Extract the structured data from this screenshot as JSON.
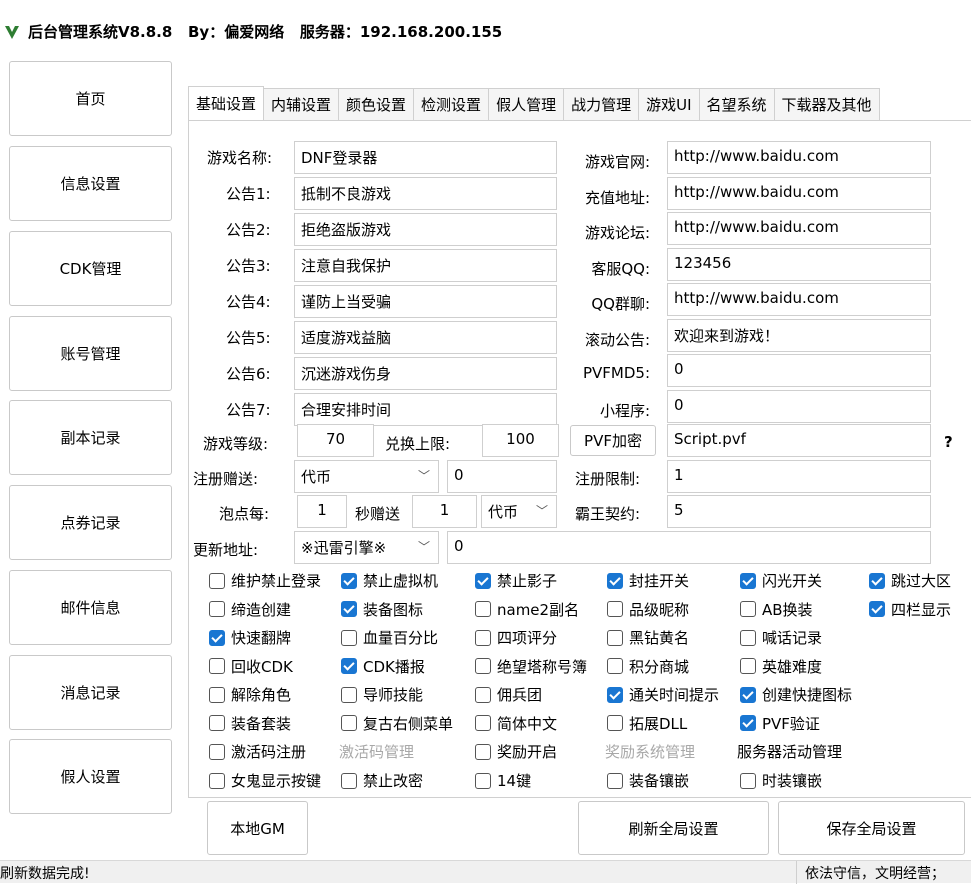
{
  "title": "后台管理系统V8.8.8   By：偏爱网络   服务器：192.168.200.155",
  "colors": {
    "accent": "#1976d2",
    "logo": "#2e7d32"
  },
  "icons": {
    "logo": "v-logo-icon",
    "chevron": "chevron-down-icon"
  },
  "sidebar": [
    "首页",
    "信息设置",
    "CDK管理",
    "账号管理",
    "副本记录",
    "点券记录",
    "邮件信息",
    "消息记录",
    "假人设置"
  ],
  "tabs": [
    "基础设置",
    "内辅设置",
    "颜色设置",
    "检测设置",
    "假人管理",
    "战力管理",
    "游戏UI",
    "名望系统",
    "下载器及其他"
  ],
  "form": {
    "game_name_label": "游戏名称:",
    "game_name": "DNF登录器",
    "notices": [
      {
        "label": "公告1:",
        "value": "抵制不良游戏"
      },
      {
        "label": "公告2:",
        "value": "拒绝盗版游戏"
      },
      {
        "label": "公告3:",
        "value": "注意自我保护"
      },
      {
        "label": "公告4:",
        "value": "谨防上当受骗"
      },
      {
        "label": "公告5:",
        "value": "适度游戏益脑"
      },
      {
        "label": "公告6:",
        "value": "沉迷游戏伤身"
      },
      {
        "label": "公告7:",
        "value": "合理安排时间"
      }
    ],
    "right": [
      {
        "label": "游戏官网:",
        "value": "http://www.baidu.com"
      },
      {
        "label": "充值地址:",
        "value": "http://www.baidu.com"
      },
      {
        "label": "游戏论坛:",
        "value": "http://www.baidu.com"
      },
      {
        "label": "客服QQ:",
        "value": "123456"
      },
      {
        "label": "QQ群聊:",
        "value": "http://www.baidu.com"
      },
      {
        "label": "滚动公告:",
        "value": "欢迎来到游戏！"
      },
      {
        "label": "PVFMD5:",
        "value": "0"
      },
      {
        "label": "小程序:",
        "value": "0"
      }
    ],
    "level_label": "游戏等级:",
    "level": "70",
    "exchange_label": "兑换上限:",
    "exchange": "100",
    "pvf_encrypt": "PVF加密",
    "pvf_file": "Script.pvf",
    "help": "?",
    "reg_gift_label": "注册赠送:",
    "reg_gift_type": "代币",
    "reg_gift_amount": "0",
    "reg_limit_label": "注册限制:",
    "reg_limit": "1",
    "bubble_label": "泡点每:",
    "bubble_every": "1",
    "bubble_sec_label": "秒赠送",
    "bubble_amount": "1",
    "bubble_type": "代币",
    "contract_label": "霸王契约:",
    "contract": "5",
    "update_label": "更新地址:",
    "update_source": "※迅雷引擎※",
    "update_value": "0"
  },
  "checkboxes": [
    [
      {
        "label": "维护禁止登录",
        "checked": false
      },
      {
        "label": "禁止虚拟机",
        "checked": true
      },
      {
        "label": "禁止影子",
        "checked": true
      },
      {
        "label": "封挂开关",
        "checked": true
      },
      {
        "label": "闪光开关",
        "checked": true
      },
      {
        "label": "跳过大区",
        "checked": true
      }
    ],
    [
      {
        "label": "缔造创建",
        "checked": false
      },
      {
        "label": "装备图标",
        "checked": true
      },
      {
        "label": "name2副名",
        "checked": false
      },
      {
        "label": "品级昵称",
        "checked": false
      },
      {
        "label": "AB换装",
        "checked": false
      },
      {
        "label": "四栏显示",
        "checked": true
      }
    ],
    [
      {
        "label": "快速翻牌",
        "checked": true
      },
      {
        "label": "血量百分比",
        "checked": false
      },
      {
        "label": "四项评分",
        "checked": false
      },
      {
        "label": "黑钻黄名",
        "checked": false
      },
      {
        "label": "喊话记录",
        "checked": false
      }
    ],
    [
      {
        "label": "回收CDK",
        "checked": false
      },
      {
        "label": "CDK播报",
        "checked": true
      },
      {
        "label": "绝望塔称号簿",
        "checked": false
      },
      {
        "label": "积分商城",
        "checked": false
      },
      {
        "label": "英雄难度",
        "checked": false
      }
    ],
    [
      {
        "label": "解除角色",
        "checked": false
      },
      {
        "label": "导师技能",
        "checked": false
      },
      {
        "label": "佣兵团",
        "checked": false
      },
      {
        "label": "通关时间提示",
        "checked": true
      },
      {
        "label": "创建快捷图标",
        "checked": true
      }
    ],
    [
      {
        "label": "装备套装",
        "checked": false
      },
      {
        "label": "复古右侧菜单",
        "checked": false
      },
      {
        "label": "简体中文",
        "checked": false
      },
      {
        "label": "拓展DLL",
        "checked": false
      },
      {
        "label": "PVF验证",
        "checked": true
      }
    ]
  ],
  "extra_row": {
    "activation": "激活码注册",
    "activation_mgmt": "激活码管理",
    "reward_open": "奖励开启",
    "reward_mgmt": "奖励系统管理",
    "server_activity": "服务器活动管理"
  },
  "last_row": [
    {
      "label": "女鬼显示按键",
      "checked": false
    },
    {
      "label": "禁止改密",
      "checked": false
    },
    {
      "label": "14键",
      "checked": false
    },
    {
      "label": "装备镶嵌",
      "checked": false
    },
    {
      "label": "时装镶嵌",
      "checked": false
    }
  ],
  "buttons": {
    "local_gm": "本地GM",
    "refresh": "刷新全局设置",
    "save": "保存全局设置"
  },
  "status": {
    "left": "刷新数据完成!",
    "right": "依法守信，文明经营；"
  }
}
